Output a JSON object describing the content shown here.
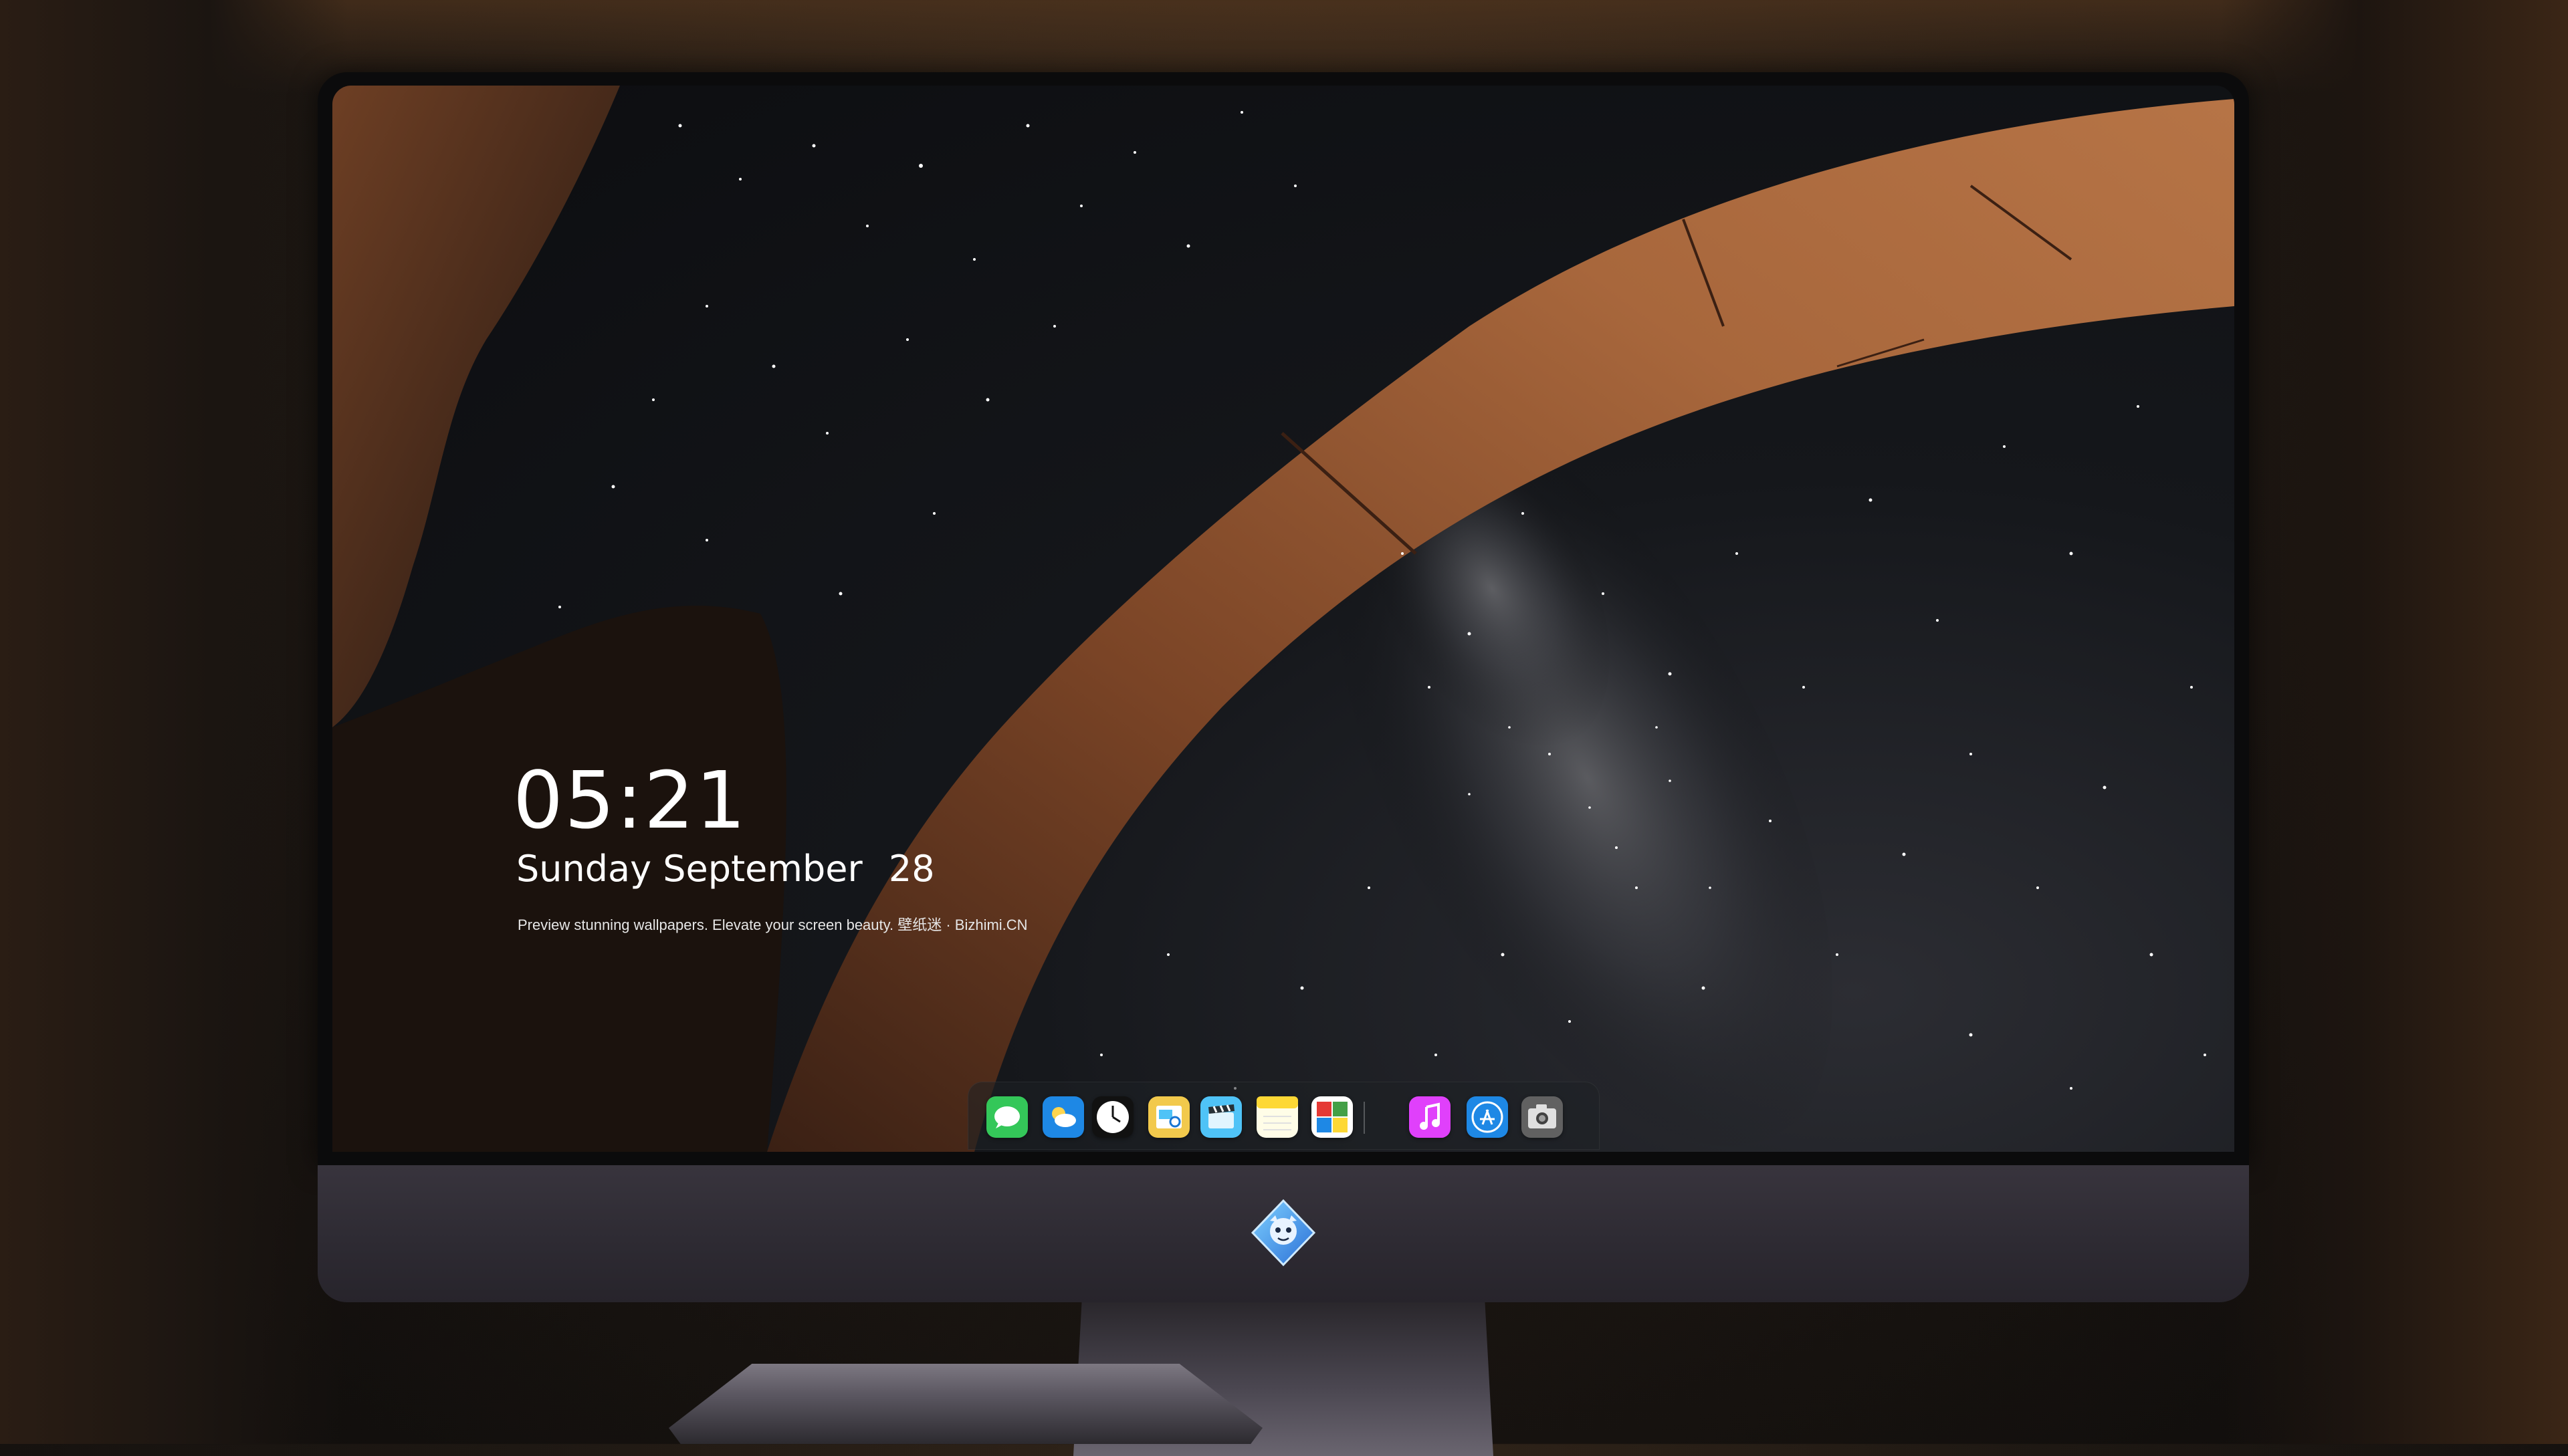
{
  "lock_screen": {
    "time": "05:21",
    "weekday": "Sunday",
    "month": "September",
    "day": "28",
    "caption": "Preview stunning wallpapers. Elevate your screen beauty. 壁纸迷 · Bizhimi.CN"
  },
  "dock": {
    "apps": [
      {
        "icon": "messages-icon",
        "color": "#34c759"
      },
      {
        "icon": "weather-icon",
        "color": "#1e88e5"
      },
      {
        "icon": "clock-icon",
        "color": "#111111"
      },
      {
        "icon": "preview-icon",
        "color": "#f2c94c"
      },
      {
        "icon": "clips-icon",
        "color": "#4fc3f7"
      },
      {
        "icon": "notes-icon",
        "color": "#fdd835"
      },
      {
        "icon": "photo-booth-icon",
        "color": "#e53935"
      }
    ],
    "pinned": [
      {
        "icon": "music-icon",
        "color": "#e040fb"
      },
      {
        "icon": "app-store-icon",
        "color": "#1e88e5"
      },
      {
        "icon": "camera-icon",
        "color": "#616161"
      }
    ]
  },
  "colors": {
    "rock": "#a0623a",
    "sky": "#101216",
    "chin": "#38343d"
  }
}
